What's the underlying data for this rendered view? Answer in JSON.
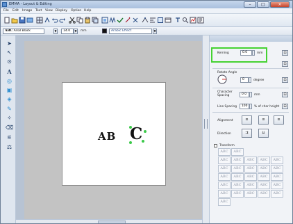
{
  "window": {
    "title": "EMMA - Layout & Editing",
    "controls": [
      "–",
      "□",
      "×"
    ]
  },
  "menubar": [
    "File",
    "Edit",
    "Image",
    "Text",
    "View",
    "Display",
    "Option",
    "Help"
  ],
  "toolbar2": {
    "font_sample": "ABC",
    "font_name": "Arial Black",
    "size_value": "14.0",
    "size_unit": "mm",
    "effect_name": "Arabic Effect"
  },
  "canvas": {
    "text_part1": "AB",
    "text_part2": "C"
  },
  "panel": {
    "kerning_label": "Kerning",
    "kerning_value": "0.0",
    "kerning_unit": "mm",
    "rotate_label": "Rotate Angle",
    "rotate_value": "0",
    "rotate_unit": "degree",
    "char_spacing_label": "Character Spacing",
    "char_spacing_value": "0.0",
    "char_spacing_unit": "mm",
    "line_spacing_label": "Line Spacing",
    "line_spacing_value": "100",
    "line_spacing_unit": "% of char height",
    "alignment_label": "Alignment",
    "direction_label": "Direction",
    "transform_label": "Transform",
    "effects": [
      "ABC",
      "ABC",
      "ABC",
      "ABC",
      "ABC",
      "ABC",
      "ABC",
      "ABC",
      "ABC",
      "ABC",
      "ABC",
      "ABC",
      "ABC",
      "ABC",
      "ABC",
      "ABC",
      "ABC",
      "ABC",
      "ABC",
      "ABC",
      "ABC",
      "ABC",
      "ABC",
      "ABC",
      "ABC",
      "ABC",
      "ABC",
      "ABC"
    ]
  },
  "colors": {
    "highlight": "#45d232",
    "selection_handle": "#3cc94a",
    "canvas_gray": "#c3c3c3"
  }
}
